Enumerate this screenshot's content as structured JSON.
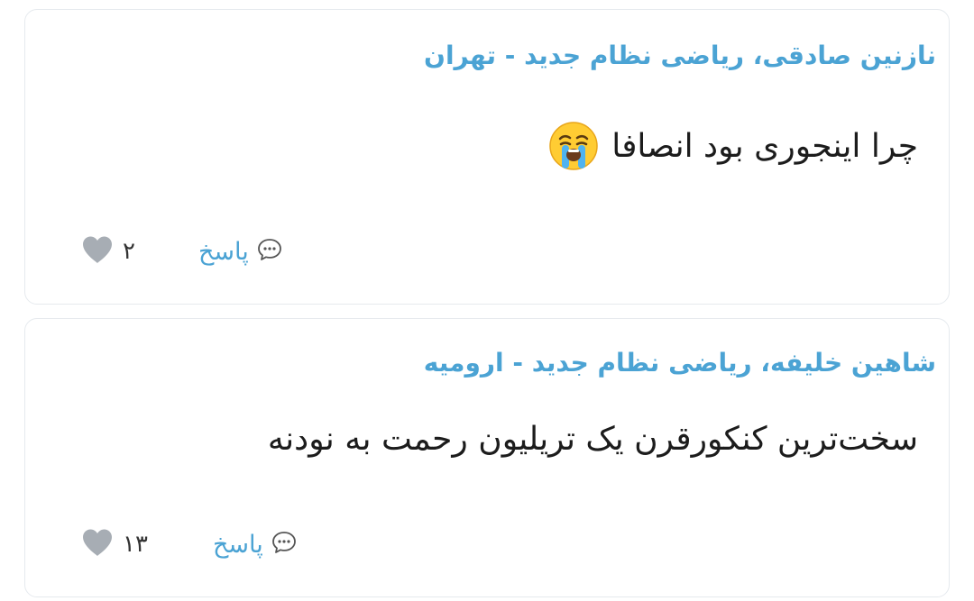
{
  "comments": [
    {
      "author": "نازنین صادقی، ریاضی نظام جدید - تهران",
      "text": "چرا اینجوری بود انصافا",
      "reply_label": "پاسخ",
      "like_count": "۲",
      "emoji": "loudly-crying-face"
    },
    {
      "author": "شاهین خلیفه، ریاضی نظام جدید - ارومیه",
      "text": "سخت‌ترین کنکورقرن یک تریلیون رحمت به نودنه",
      "reply_label": "پاسخ",
      "like_count": "۱۳"
    }
  ],
  "colors": {
    "author": "#4ba3d4",
    "reply": "#4ba3d4",
    "heart": "#a7adb4",
    "card_border": "#e6eaee"
  }
}
